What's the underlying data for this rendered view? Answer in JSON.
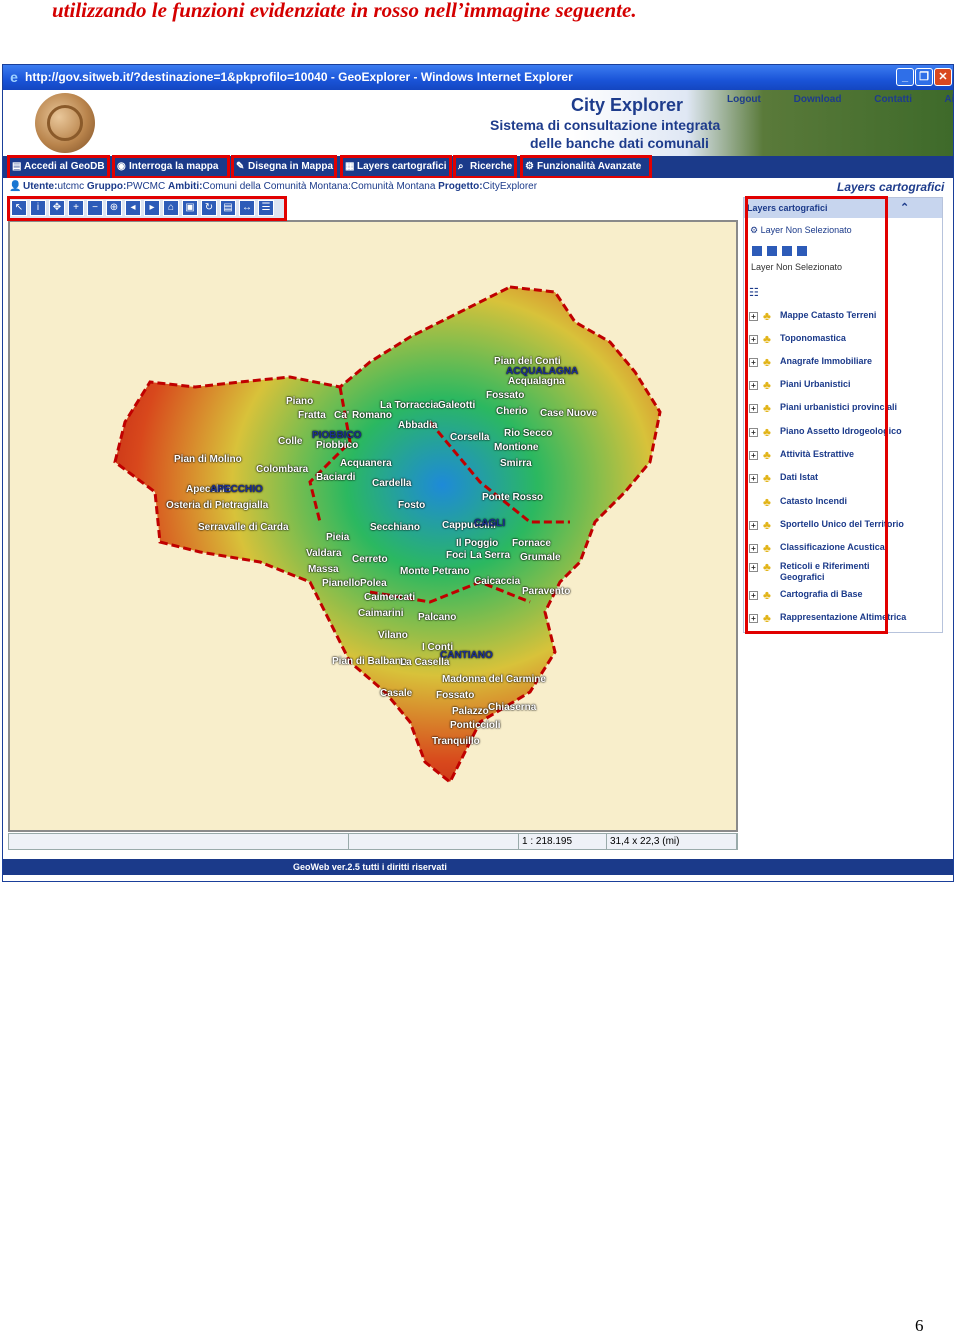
{
  "document": {
    "heading": "utilizzando le funzioni evidenziate in rosso nell’immagine seguente.",
    "page_number": "6"
  },
  "window": {
    "title": "http://gov.sitweb.it/?destinazione=1&pkprofilo=10040 - GeoExplorer - Windows Internet Explorer",
    "controls": [
      "_",
      "❐",
      "✕"
    ]
  },
  "banner": {
    "title": "City Explorer",
    "subtitle_line1": "Sistema di consultazione integrata",
    "subtitle_line2": "delle banche dati comunali",
    "links": [
      "Logout",
      "Download",
      "Contatti",
      "Aiuto"
    ]
  },
  "menu": {
    "items": [
      {
        "label": "Accedi al GeoDB",
        "icon": "document-icon"
      },
      {
        "label": "Interroga la mappa",
        "icon": "info-icon"
      },
      {
        "label": "Disegna in Mappa",
        "icon": "pencil-icon"
      },
      {
        "label": "Layers cartografici",
        "icon": "layers-icon"
      },
      {
        "label": "Ricerche",
        "icon": "search-icon"
      },
      {
        "label": "Funzionalità Avanzate",
        "icon": "advanced-icon"
      }
    ]
  },
  "infobar": {
    "user_label": "Utente:",
    "user": "utcmc",
    "group_label": "Gruppo:",
    "group": "PWCMC",
    "scope_label": "Ambiti:",
    "scope": "Comuni della Comunità Montana:Comunità Montana",
    "project_label": "Progetto:",
    "project": "CityExplorer",
    "layers_heading": "Layers cartografici"
  },
  "toolbar": {
    "tools": [
      "pointer-tool",
      "info-tool",
      "pan-tool",
      "zoom-in-tool",
      "zoom-out-tool",
      "zoom-box-tool",
      "zoom-prev-tool",
      "zoom-next-tool",
      "zoom-full-tool",
      "zoom-layer-tool",
      "refresh-tool",
      "print-tool",
      "measure-tool"
    ]
  },
  "map": {
    "places": [
      "Pian dei Conti",
      "ACQUALAGNA",
      "Acqualagna",
      "Fossato",
      "Piano",
      "La Torraccia",
      "Galeotti",
      "Fratta",
      "Ca' Romano",
      "Cherio",
      "Case Nuove",
      "Abbadia",
      "Colle",
      "PIOBBICO",
      "Piobbico",
      "Corsella",
      "Rio Secco",
      "Montione",
      "Pian di Molino",
      "Acquanera",
      "Smirra",
      "Colombara",
      "Baciardi",
      "Cardella",
      "Apecchio",
      "APECCHIO",
      "Ponte Rosso",
      "Osteria di Pietragialla",
      "Fosto",
      "Serravalle di Carda",
      "Secchiano",
      "Cappuccini",
      "CAGLI",
      "Pieia",
      "Il Poggio",
      "Fornace",
      "Valdara",
      "Foci",
      "La Serra",
      "Grumale",
      "Cerreto",
      "Massa",
      "Monte Petrano",
      "Caicaccia",
      "Pianello",
      "Polea",
      "Paravento",
      "Caimercati",
      "Caimarini",
      "Palcano",
      "Vilano",
      "I Conti",
      "CANTIANO",
      "Pian di Balbano",
      "La Casella",
      "Madonna del Carmine",
      "Casale",
      "Fossato",
      "Palazzo",
      "Chiaserna",
      "Ponticcioli",
      "Tranquillo"
    ]
  },
  "statusbar": {
    "scale": "1 : 218.195",
    "extent": "31,4 x 22,3 (mi)"
  },
  "footer": {
    "text": "GeoWeb ver.2.5 tutti i diritti riservati"
  },
  "panel": {
    "header": "Layers cartografici",
    "selector_label": "Layer Non Selezionato",
    "caption": "Layer Non Selezionato",
    "tree": [
      "Mappe Catasto Terreni",
      "Toponomastica",
      "Anagrafe Immobiliare",
      "Piani Urbanistici",
      "Piani urbanistici provinciali",
      "Piano Assetto Idrogeologico",
      "Attività Estrattive",
      "Dati Istat",
      "Catasto Incendi",
      "Sportello Unico del Territorio",
      "Classificazione Acustica",
      "Reticoli e Riferimenti Geografici",
      "Cartografia di Base",
      "Rappresentazione Altimetrica"
    ]
  },
  "colors": {
    "highlight_red": "#e10000",
    "menu_blue": "#1b3a8a",
    "map_background": "#f8eecb"
  }
}
